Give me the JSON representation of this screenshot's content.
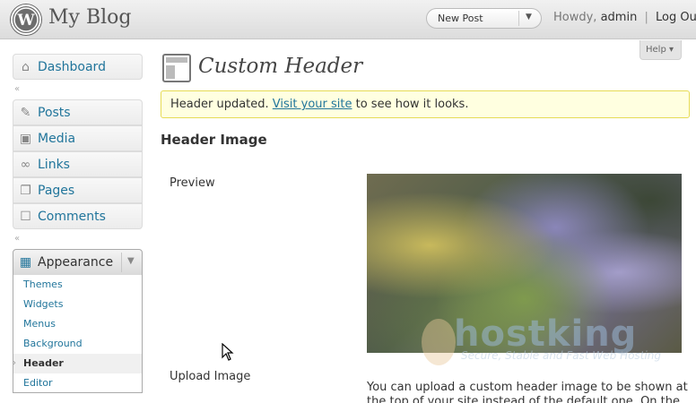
{
  "header": {
    "blog_title": "My Blog",
    "new_post_label": "New Post",
    "howdy_prefix": "Howdy,",
    "username": "admin",
    "separator": "|",
    "logout_label": "Log Out",
    "help_label": "Help ▾"
  },
  "sidebar": {
    "dashboard": "Dashboard",
    "items": [
      {
        "label": "Posts",
        "icon": "pin-icon"
      },
      {
        "label": "Media",
        "icon": "media-icon"
      },
      {
        "label": "Links",
        "icon": "link-icon"
      },
      {
        "label": "Pages",
        "icon": "pages-icon"
      },
      {
        "label": "Comments",
        "icon": "comment-icon"
      }
    ],
    "appearance": "Appearance",
    "submenu": [
      "Themes",
      "Widgets",
      "Menus",
      "Background",
      "Header",
      "Editor"
    ],
    "current_submenu": "Header"
  },
  "main": {
    "title": "Custom Header",
    "notice_before": "Header updated.",
    "notice_link": "Visit your site",
    "notice_after": "to see how it looks.",
    "section_heading": "Header Image",
    "preview_label": "Preview",
    "upload_label": "Upload Image",
    "description": "You can upload a custom header image to be shown at the top of your site instead of the default one. On the"
  },
  "watermark": {
    "name": "hostking",
    "tagline": "Secure, Stable and Fast Web Hosting"
  }
}
